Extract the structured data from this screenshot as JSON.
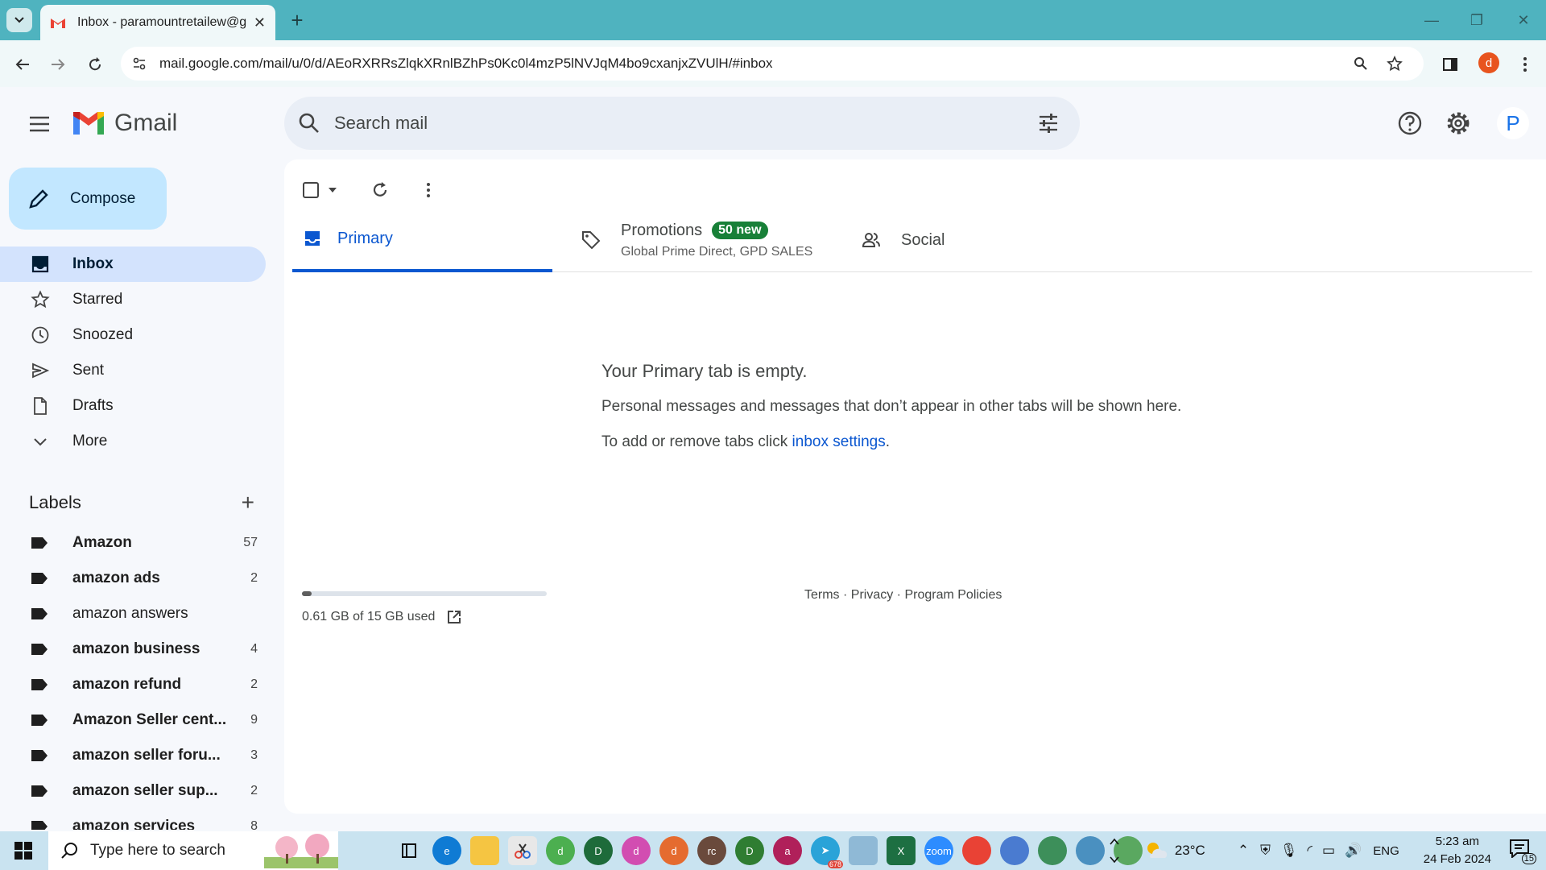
{
  "browser": {
    "tab_title": "Inbox - paramountretailew@gm",
    "url": "mail.google.com/mail/u/0/d/AEoRXRRsZlqkXRnlBZhPs0Kc0l4mzP5lNVJqM4bo9cxanjxZVUlH/#inbox",
    "profile_initial": "d"
  },
  "header": {
    "app_name": "Gmail",
    "search_placeholder": "Search mail",
    "account_initial": "P"
  },
  "compose": {
    "label": "Compose"
  },
  "nav": [
    {
      "label": "Inbox",
      "active": true
    },
    {
      "label": "Starred"
    },
    {
      "label": "Snoozed"
    },
    {
      "label": "Sent"
    },
    {
      "label": "Drafts"
    },
    {
      "label": "More"
    }
  ],
  "labels": {
    "heading": "Labels",
    "items": [
      {
        "name": "Amazon",
        "count": "57",
        "bold": true
      },
      {
        "name": "amazon ads",
        "count": "2",
        "bold": true
      },
      {
        "name": "amazon answers",
        "count": "",
        "bold": false
      },
      {
        "name": "amazon business",
        "count": "4",
        "bold": true
      },
      {
        "name": "amazon refund",
        "count": "2",
        "bold": true
      },
      {
        "name": "Amazon Seller cent...",
        "count": "9",
        "bold": true
      },
      {
        "name": "amazon seller foru...",
        "count": "3",
        "bold": true
      },
      {
        "name": "amazon seller sup...",
        "count": "2",
        "bold": true
      },
      {
        "name": "amazon services",
        "count": "8",
        "bold": true
      }
    ]
  },
  "tabs": {
    "primary": "Primary",
    "promotions": "Promotions",
    "promotions_badge": "50 new",
    "promotions_sub": "Global Prime Direct, GPD SALES",
    "social": "Social"
  },
  "empty_state": {
    "title": "Your Primary tab is empty.",
    "line1": "Personal messages and messages that don’t appear in other tabs will be shown here.",
    "line2_prefix": "To add or remove tabs click ",
    "line2_link": "inbox settings",
    "line2_suffix": "."
  },
  "storage": {
    "text": "0.61 GB of 15 GB used",
    "used_fraction": 0.04
  },
  "footer": {
    "terms": "Terms",
    "privacy": "Privacy",
    "policies": "Program Policies",
    "sep": " · "
  },
  "taskbar": {
    "search_placeholder": "Type here to search",
    "weather": "23°C",
    "lang": "ENG",
    "time": "5:23 am",
    "date": "24 Feb 2024",
    "notif_count": "15",
    "telegram_badge": "678"
  },
  "colors": {
    "accent": "#0b57d0",
    "compose_bg": "#c2e7ff",
    "active_nav": "#d3e3fd",
    "badge": "#188038"
  }
}
